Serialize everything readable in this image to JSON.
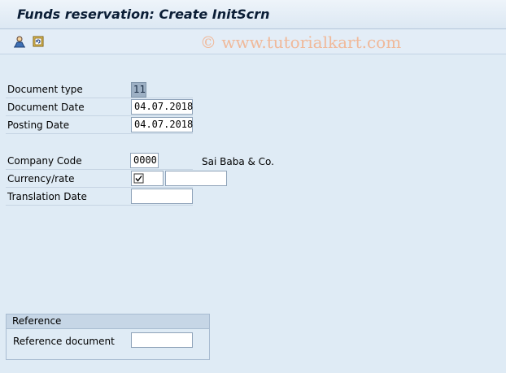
{
  "window": {
    "title": "Funds reservation: Create InitScrn"
  },
  "toolbar": {
    "icons": [
      "person-icon",
      "refresh-icon"
    ]
  },
  "watermark": "© www.tutorialkart.com",
  "form": {
    "document_type": {
      "label": "Document type",
      "value": "11"
    },
    "document_date": {
      "label": "Document Date",
      "value": "04.07.2018"
    },
    "posting_date": {
      "label": "Posting Date",
      "value": "04.07.2018"
    },
    "company_code": {
      "label": "Company Code",
      "value": "0000",
      "description": "Sai Baba & Co."
    },
    "currency_rate": {
      "label": "Currency/rate",
      "checkbox": "checked",
      "value": ""
    },
    "translation_date": {
      "label": "Translation Date",
      "value": ""
    }
  },
  "reference": {
    "group_title": "Reference",
    "document": {
      "label": "Reference document",
      "value": ""
    }
  },
  "colors": {
    "background": "#dfebf5",
    "title": "#0b1e36",
    "watermark": "#f0b99a"
  }
}
